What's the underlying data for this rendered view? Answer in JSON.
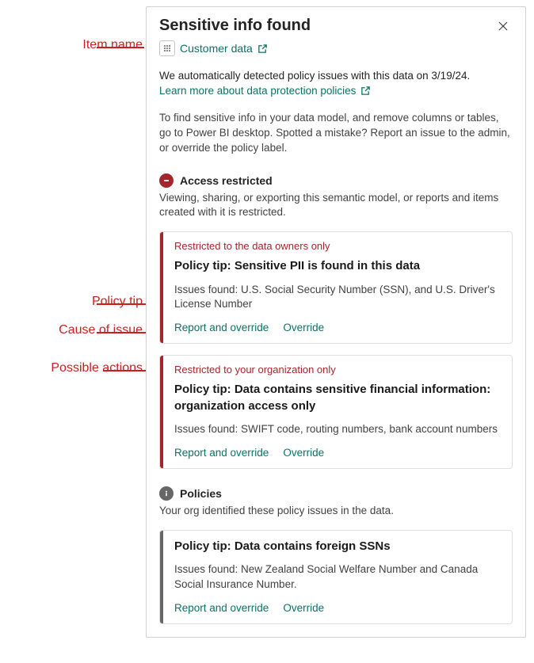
{
  "annotations": {
    "item_name": "Item name",
    "policy_tip": "Policy tip",
    "cause": "Cause of issue",
    "actions": "Possible actions"
  },
  "dialog": {
    "title": "Sensitive info found",
    "item_name": "Customer data",
    "detected_text": "We automatically detected policy issues with this data on 3/19/24.",
    "learn_more": "Learn more about data protection policies",
    "instructions": "To find sensitive info in your data model, and remove columns or tables, go to Power BI desktop. Spotted a mistake? Report an issue to the admin, or override the policy label.",
    "sections": {
      "access": {
        "title": "Access restricted",
        "sub": "Viewing, sharing, or exporting this semantic model, or reports and items created with it is restricted."
      },
      "policies": {
        "title": "Policies",
        "sub": "Your org identified these policy issues in the data."
      }
    },
    "cards": [
      {
        "restriction": "Restricted to the data owners only",
        "tip": "Policy tip: Sensitive PII is found in this data",
        "issues": "Issues found: U.S. Social Security Number (SSN), and U.S. Driver's License Number",
        "action1": "Report and override",
        "action2": "Override"
      },
      {
        "restriction": "Restricted to your organization only",
        "tip": "Policy tip: Data contains sensitive financial information: organization access only",
        "issues": "Issues found: SWIFT code, routing numbers, bank account numbers",
        "action1": "Report and override",
        "action2": "Override"
      },
      {
        "tip": "Policy tip: Data contains foreign SSNs",
        "issues": "Issues found: New Zealand Social Welfare Number and Canada Social Insurance Number.",
        "action1": "Report and override",
        "action2": "Override"
      }
    ]
  }
}
